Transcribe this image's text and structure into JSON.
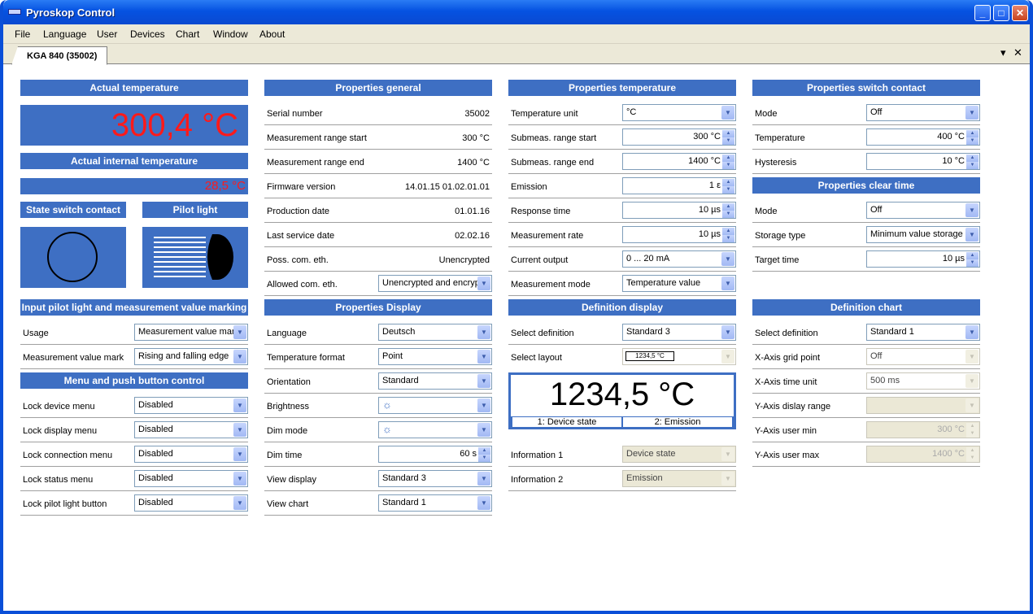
{
  "window": {
    "title": "Pyroskop Control",
    "min": "_",
    "max": "□",
    "close": "✕"
  },
  "menu": [
    "File",
    "Language",
    "User",
    "Devices",
    "Chart",
    "Window",
    "About"
  ],
  "tab": {
    "label": "KGA 840 (35002)",
    "dropdown": "▾",
    "close": "✕"
  },
  "col1": {
    "actual_temp_header": "Actual temperature",
    "actual_temp_value": "300,4 °C",
    "internal_temp_header": "Actual internal temperature",
    "internal_temp_value": "28,5 °C",
    "state_switch_header": "State switch contact",
    "pilot_light_header": "Pilot light",
    "input_pilot_header": "Input pilot light and measurement value marking",
    "usage_label": "Usage",
    "usage_value": "Measurement value marking",
    "mvm_label": "Measurement value mark",
    "mvm_value": "Rising and falling edge",
    "menu_push_header": "Menu and push button control",
    "lock_device_label": "Lock device menu",
    "lock_device_value": "Disabled",
    "lock_display_label": "Lock display menu",
    "lock_display_value": "Disabled",
    "lock_connection_label": "Lock connection menu",
    "lock_connection_value": "Disabled",
    "lock_status_label": "Lock status menu",
    "lock_status_value": "Disabled",
    "lock_pilot_label": "Lock pilot light button",
    "lock_pilot_value": "Disabled"
  },
  "col2": {
    "general_header": "Properties general",
    "serial_label": "Serial number",
    "serial_value": "35002",
    "range_start_label": "Measurement range start",
    "range_start_value": "300 °C",
    "range_end_label": "Measurement range end",
    "range_end_value": "1400 °C",
    "firmware_label": "Firmware version",
    "firmware_value": "14.01.15 01.02.01.01",
    "production_label": "Production date",
    "production_value": "01.01.16",
    "service_label": "Last service date",
    "service_value": "02.02.16",
    "poss_label": "Poss. com. eth.",
    "poss_value": "Unencrypted",
    "allowed_label": "Allowed com. eth.",
    "allowed_value": "Unencrypted and encrypted",
    "display_header": "Properties Display",
    "language_label": "Language",
    "language_value": "Deutsch",
    "tempformat_label": "Temperature format",
    "tempformat_value": "Point",
    "orientation_label": "Orientation",
    "orientation_value": "Standard",
    "brightness_label": "Brightness",
    "brightness_icon": "☼",
    "dimmode_label": "Dim mode",
    "dimmode_icon": "☼",
    "dimtime_label": "Dim time",
    "dimtime_value": "60 s",
    "viewdisplay_label": "View display",
    "viewdisplay_value": "Standard 3",
    "viewchart_label": "View chart",
    "viewchart_value": "Standard 1"
  },
  "col3": {
    "temp_header": "Properties temperature",
    "unit_label": "Temperature unit",
    "unit_value": "°C",
    "sub_start_label": "Submeas. range start",
    "sub_start_value": "300 °C",
    "sub_end_label": "Submeas. range end",
    "sub_end_value": "1400 °C",
    "emission_label": "Emission",
    "emission_value": "1 ε",
    "response_label": "Response time",
    "response_value": "10 µs",
    "rate_label": "Measurement rate",
    "rate_value": "10 µs",
    "current_label": "Current output",
    "current_value": "0 ... 20 mA",
    "mode_label": "Measurement mode",
    "mode_value": "Temperature value",
    "defdisp_header": "Definition display",
    "seldef_label": "Select definition",
    "seldef_value": "Standard 3",
    "sellayout_label": "Select layout",
    "sellayout_value": "1234,5 °C",
    "preview_value": "1234,5 °C",
    "preview_info1": "1: Device state",
    "preview_info2": "2: Emission",
    "info1_label": "Information 1",
    "info1_value": "Device state",
    "info2_label": "Information 2",
    "info2_value": "Emission"
  },
  "col4": {
    "switch_header": "Properties switch contact",
    "mode_label": "Mode",
    "mode_value": "Off",
    "temp_label": "Temperature",
    "temp_value": "400 °C",
    "hyst_label": "Hysteresis",
    "hyst_value": "10 °C",
    "clear_header": "Properties clear time",
    "cmode_label": "Mode",
    "cmode_value": "Off",
    "storage_label": "Storage type",
    "storage_value": "Minimum value storage",
    "target_label": "Target time",
    "target_value": "10 µs",
    "defchart_header": "Definition chart",
    "cdef_label": "Select definition",
    "cdef_value": "Standard 1",
    "xgrid_label": "X-Axis grid point",
    "xgrid_value": "Off",
    "xunit_label": "X-Axis time unit",
    "xunit_value": "500 ms",
    "yrange_label": "Y-Axis dislay range",
    "yrange_value": "",
    "ymin_label": "Y-Axis user min",
    "ymin_value": "300 °C",
    "ymax_label": "Y-Axis user max",
    "ymax_value": "1400 °C"
  }
}
